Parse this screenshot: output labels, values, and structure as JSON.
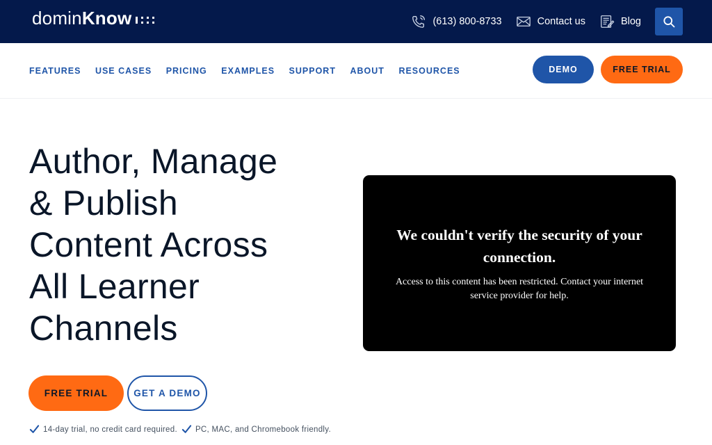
{
  "brand": {
    "logo_light": "domin",
    "logo_bold": "Know"
  },
  "topbar": {
    "phone": "(613) 800-8733",
    "contact": "Contact us",
    "blog": "Blog",
    "icons": {
      "phone": "phone-icon",
      "contact": "envelope-icon",
      "blog": "blog-icon",
      "search": "search-icon"
    }
  },
  "nav": {
    "items": [
      "FEATURES",
      "USE CASES",
      "PRICING",
      "EXAMPLES",
      "SUPPORT",
      "ABOUT",
      "RESOURCES"
    ],
    "demo_label": "DEMO",
    "trial_label": "FREE TRIAL"
  },
  "hero": {
    "title_lines": [
      "Author, Manage",
      "& Publish",
      "Content Across",
      "All Learner",
      "Channels"
    ],
    "trial_label": "FREE TRIAL",
    "demo_label": "GET A DEMO",
    "checks": [
      "14-day trial, no credit card required.",
      "PC, MAC, and Chromebook friendly."
    ]
  },
  "video": {
    "title": "We couldn't verify the security of your connection.",
    "message": "Access to this content has been restricted. Contact your internet service provider for help."
  },
  "colors": {
    "topbar_bg": "#04194b",
    "primary_blue": "#1f55a8",
    "accent_orange": "#ff6a13",
    "text_dark": "#0a1628"
  }
}
